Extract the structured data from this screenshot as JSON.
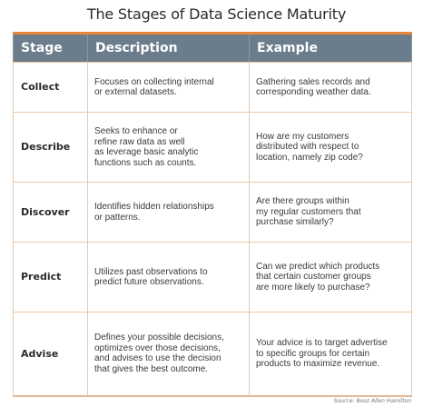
{
  "title": "The Stages of Data Science Maturity",
  "columns": {
    "stage": "Stage",
    "description": "Description",
    "example": "Example"
  },
  "rows": [
    {
      "stage": "Collect",
      "description": "Focuses on collecting internal\nor external datasets.",
      "example": "Gathering sales records and\ncorresponding weather data."
    },
    {
      "stage": "Describe",
      "description": "Seeks to enhance or\nrefine raw data as well\nas leverage basic analytic\nfunctions such as counts.",
      "example": "How are my customers\ndistributed with respect to\nlocation, namely zip code?"
    },
    {
      "stage": "Discover",
      "description": "Identifies hidden relationships\nor patterns.",
      "example": "Are there groups within\nmy regular customers that\npurchase similarly?"
    },
    {
      "stage": "Predict",
      "description": "Utilizes past observations to\npredict future observations.",
      "example": "Can we predict which products\nthat certain customer groups\nare more likely to purchase?"
    },
    {
      "stage": "Advise",
      "description": "Defines your possible decisions,\noptimizes over those decisions,\nand advises to use the decision\nthat gives the best outcome.",
      "example": "Your advice is to target advertise\nto specific groups for certain\nproducts to maximize revenue."
    }
  ],
  "source": "Source: Booz Allen Hamilton",
  "colors": {
    "header_background": "#6b7d8c",
    "header_top_rule": "#e8873a",
    "grid_lines": "#f0c8a3"
  }
}
